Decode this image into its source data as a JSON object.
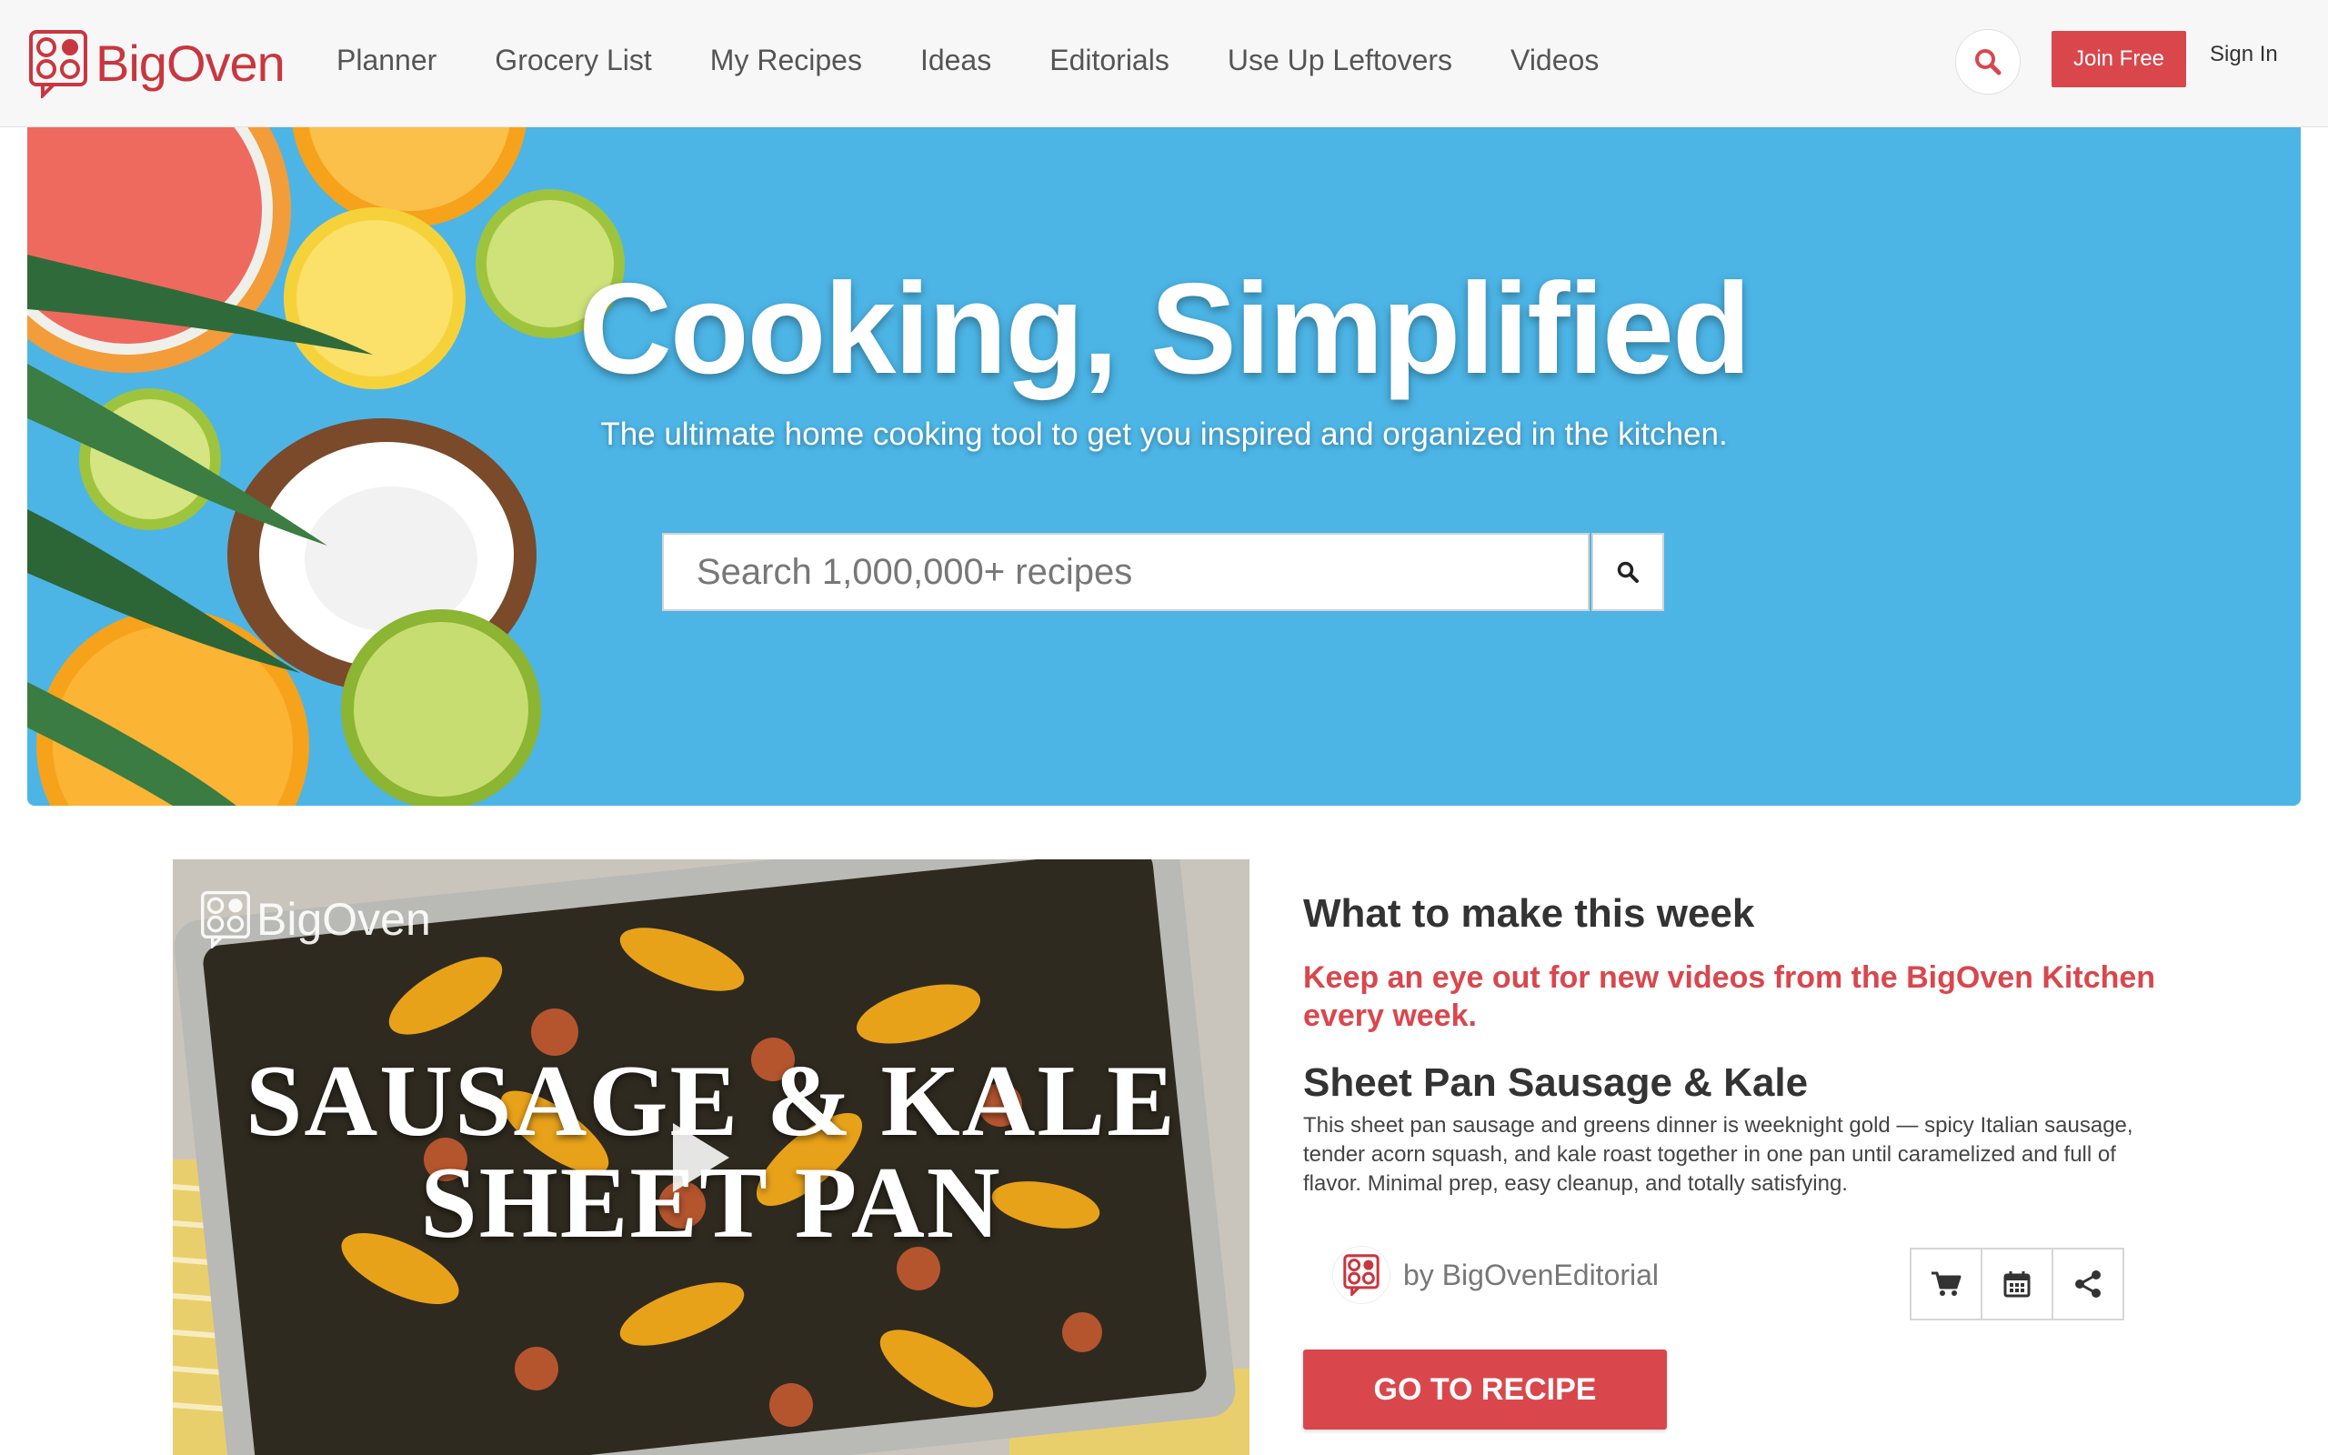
{
  "brand": {
    "name": "BigOven",
    "color": "#c8373f"
  },
  "nav": {
    "items": [
      "Planner",
      "Grocery List",
      "My Recipes",
      "Ideas",
      "Editorials",
      "Use Up Leftovers",
      "Videos"
    ]
  },
  "header": {
    "search_icon": "search-icon",
    "join_label": "Join Free",
    "signin_label": "Sign In"
  },
  "hero": {
    "title": "Cooking, Simplified",
    "subtitle": "The ultimate home cooking tool to get you inspired and organized in the kitchen.",
    "search_placeholder": "Search 1,000,000+ recipes",
    "background_color": "#4cb5e6"
  },
  "feature": {
    "heading": "What to make this week",
    "tagline": "Keep an eye out for new videos from the BigOven Kitchen every week.",
    "video_logo": "BigOven",
    "video_title_line1": "SAUSAGE & KALE",
    "video_title_line2": "SHEET PAN",
    "recipe_title": "Sheet Pan Sausage & Kale",
    "recipe_description": "This sheet pan sausage and greens dinner is weeknight gold — spicy Italian sausage, tender acorn squash, and kale roast together in one pan until caramelized and full of flavor. Minimal prep, easy cleanup, and totally satisfying.",
    "author": "by BigOvenEditorial",
    "actions": [
      "cart-icon",
      "calendar-icon",
      "share-icon"
    ],
    "cta_label": "GO TO RECIPE",
    "accent_color": "#d9474d"
  }
}
